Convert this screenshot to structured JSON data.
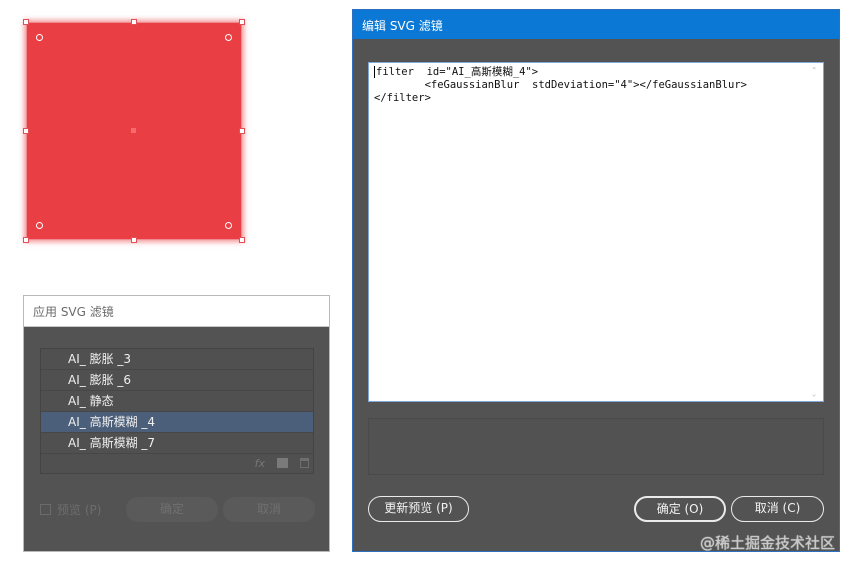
{
  "apply_dialog": {
    "title": "应用 SVG 滤镜",
    "filters": [
      {
        "label": "AI_ 膨胀 _3",
        "selected": false
      },
      {
        "label": "AI_ 膨胀 _6",
        "selected": false
      },
      {
        "label": "AI_ 静态",
        "selected": false
      },
      {
        "label": "AI_ 高斯模糊 _4",
        "selected": true
      },
      {
        "label": "AI_ 高斯模糊 _7",
        "selected": false
      }
    ],
    "fx_label": "fx",
    "preview_label": "预览 (P)",
    "ok_label": "确定",
    "cancel_label": "取消"
  },
  "edit_dialog": {
    "title": "编辑 SVG 滤镜",
    "code_lines": [
      "filter  id=\"AI_高斯模糊_4\">",
      "        <feGaussianBlur  stdDeviation=\"4\"></feGaussianBlur>",
      "</filter>"
    ],
    "update_preview_label": "更新预览 (P)",
    "ok_label": "确定 (O)",
    "cancel_label": "取消 (C)"
  },
  "watermark": "@稀土掘金技术社区",
  "colors": {
    "shape_fill": "#e93f44",
    "dialog_bg": "#535353",
    "edit_title_bar": "#0a78d4",
    "selected_row": "#4b5f7a"
  }
}
